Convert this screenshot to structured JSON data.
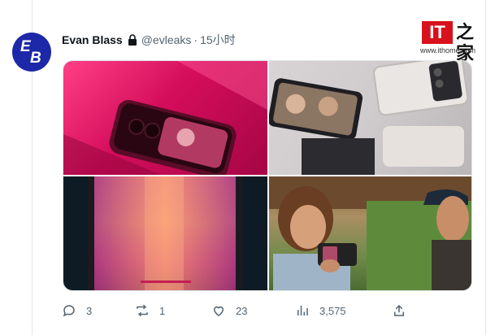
{
  "author": {
    "name": "Evan Blass",
    "handle": "@evleaks",
    "separator": "·",
    "time": "15小时",
    "avatar_initial_1": "E",
    "avatar_initial_2": "B"
  },
  "watermark": {
    "logo": "IT",
    "char": "之家",
    "url": "www.ithome.com"
  },
  "media": {
    "tiles": [
      {
        "name": "pink-flip-phone-closed"
      },
      {
        "name": "flip-phones-selfie"
      },
      {
        "name": "flip-phone-inner-display"
      },
      {
        "name": "couple-using-flip-phone"
      }
    ]
  },
  "actions": {
    "replies": "3",
    "retweets": "1",
    "likes": "23",
    "views": "3,575"
  },
  "colors": {
    "accent": "#1d28a8",
    "text": "#0f1419",
    "muted": "#536471",
    "divider": "#e1e6ea"
  }
}
